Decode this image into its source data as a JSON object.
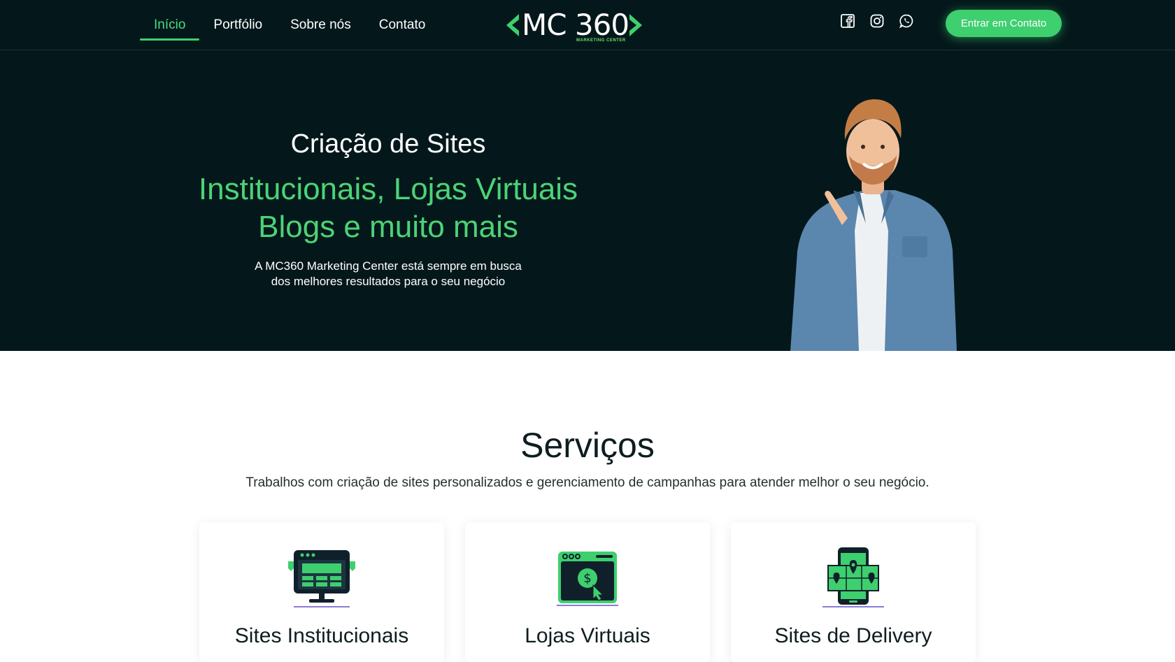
{
  "nav": {
    "items": [
      {
        "label": "Início",
        "active": true
      },
      {
        "label": "Portfólio",
        "active": false
      },
      {
        "label": "Sobre nós",
        "active": false
      },
      {
        "label": "Contato",
        "active": false
      }
    ]
  },
  "logo": {
    "text": "MC 360",
    "subtitle": "MARKETING CENTER"
  },
  "socials": [
    "facebook-icon",
    "instagram-icon",
    "whatsapp-icon"
  ],
  "header_cta": {
    "label": "Entrar em Contato"
  },
  "hero": {
    "title": "Criação de Sites",
    "subtitle_line1": "Institucionais, Lojas Virtuais",
    "subtitle_line2": "Blogs e muito mais",
    "desc_line1": "A MC360 Marketing Center está sempre em busca",
    "desc_line2": "dos melhores resultados para o seu negócio"
  },
  "services": {
    "title": "Serviços",
    "description": "Trabalhos com criação de sites personalizados e gerenciamento de campanhas para atender melhor o seu negócio.",
    "cards": [
      {
        "title": "Sites Institucionais",
        "icon": "monitor-website-icon"
      },
      {
        "title": "Lojas Virtuais",
        "icon": "online-store-icon"
      },
      {
        "title": "Sites de Delivery",
        "icon": "delivery-phone-map-icon"
      }
    ]
  },
  "colors": {
    "brand_green": "#3ecf6e",
    "dark_bg": "#04181b",
    "text_dark": "#0e1d20"
  }
}
